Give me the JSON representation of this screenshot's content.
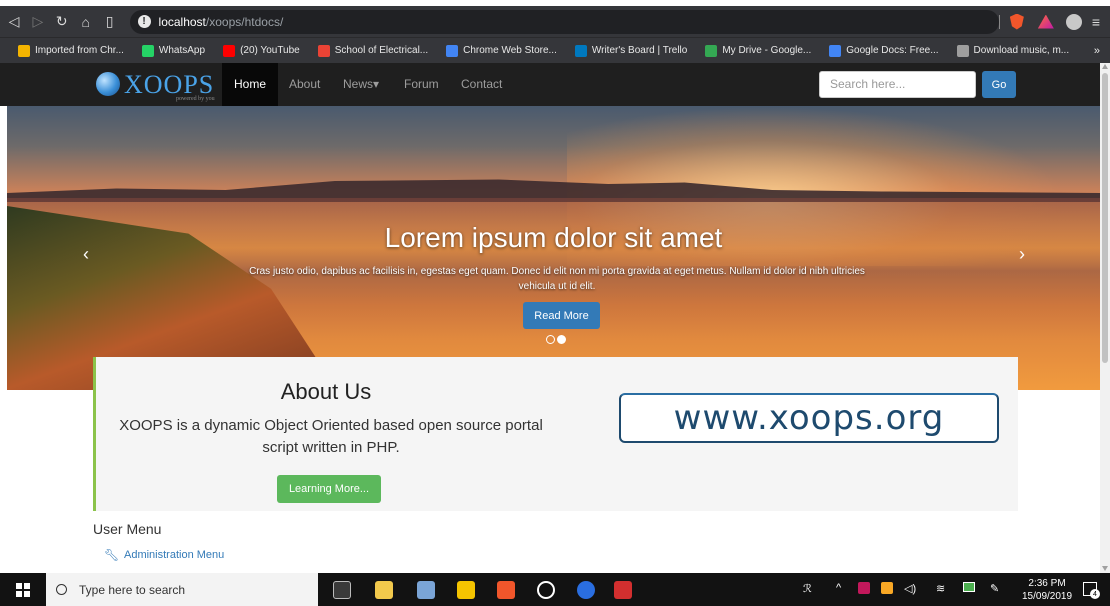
{
  "browser": {
    "url_host": "localhost",
    "url_path": "/xoops/htdocs/",
    "icons": [
      "back-icon",
      "forward-icon",
      "reload-icon",
      "home-icon",
      "bookmark-icon",
      "info-icon",
      "brave-shield-icon",
      "brave-rewards-icon",
      "profile-icon",
      "menu-icon"
    ],
    "rewards_badge": "9",
    "bookmarks": [
      {
        "label": "Imported from Chr...",
        "color": "#f4b400"
      },
      {
        "label": "WhatsApp",
        "color": "#25d366"
      },
      {
        "label": "(20) YouTube",
        "color": "#ff0000"
      },
      {
        "label": "School of Electrical...",
        "color": "#ea4335"
      },
      {
        "label": "Chrome Web Store...",
        "color": "#4285f4"
      },
      {
        "label": "Writer's Board | Trello",
        "color": "#0079bf"
      },
      {
        "label": "My Drive - Google...",
        "color": "#34a853"
      },
      {
        "label": "Google Docs: Free...",
        "color": "#4285f4"
      },
      {
        "label": "Download music, m...",
        "color": "#9e9e9e"
      }
    ],
    "more_label": "»"
  },
  "site": {
    "logo_text": "XOOPS",
    "logo_sub": "powered by you",
    "nav": [
      {
        "label": "Home",
        "active": true
      },
      {
        "label": "About"
      },
      {
        "label": "News▾"
      },
      {
        "label": "Forum"
      },
      {
        "label": "Contact"
      }
    ],
    "search_placeholder": "Search here...",
    "go_label": "Go"
  },
  "hero": {
    "title": "Lorem ipsum dolor sit amet",
    "text": "Cras justo odio, dapibus ac facilisis in, egestas eget quam. Donec id elit non mi porta gravida at eget metus. Nullam id dolor id nibh ultricies vehicula ut id elit.",
    "button_label": "Read More",
    "prev_arrow": "‹",
    "next_arrow": "›"
  },
  "about": {
    "title": "About Us",
    "text": "XOOPS is a dynamic Object Oriented based open source portal script written in PHP.",
    "button_label": "Learning More...",
    "logo_text": "www.xoops.org"
  },
  "user_menu": {
    "title": "User Menu",
    "items": [
      {
        "label": "Administration Menu"
      }
    ]
  },
  "taskbar": {
    "search_label": "Type here to search",
    "time": "2:36 PM",
    "date": "15/09/2019",
    "notification_count": "4"
  }
}
